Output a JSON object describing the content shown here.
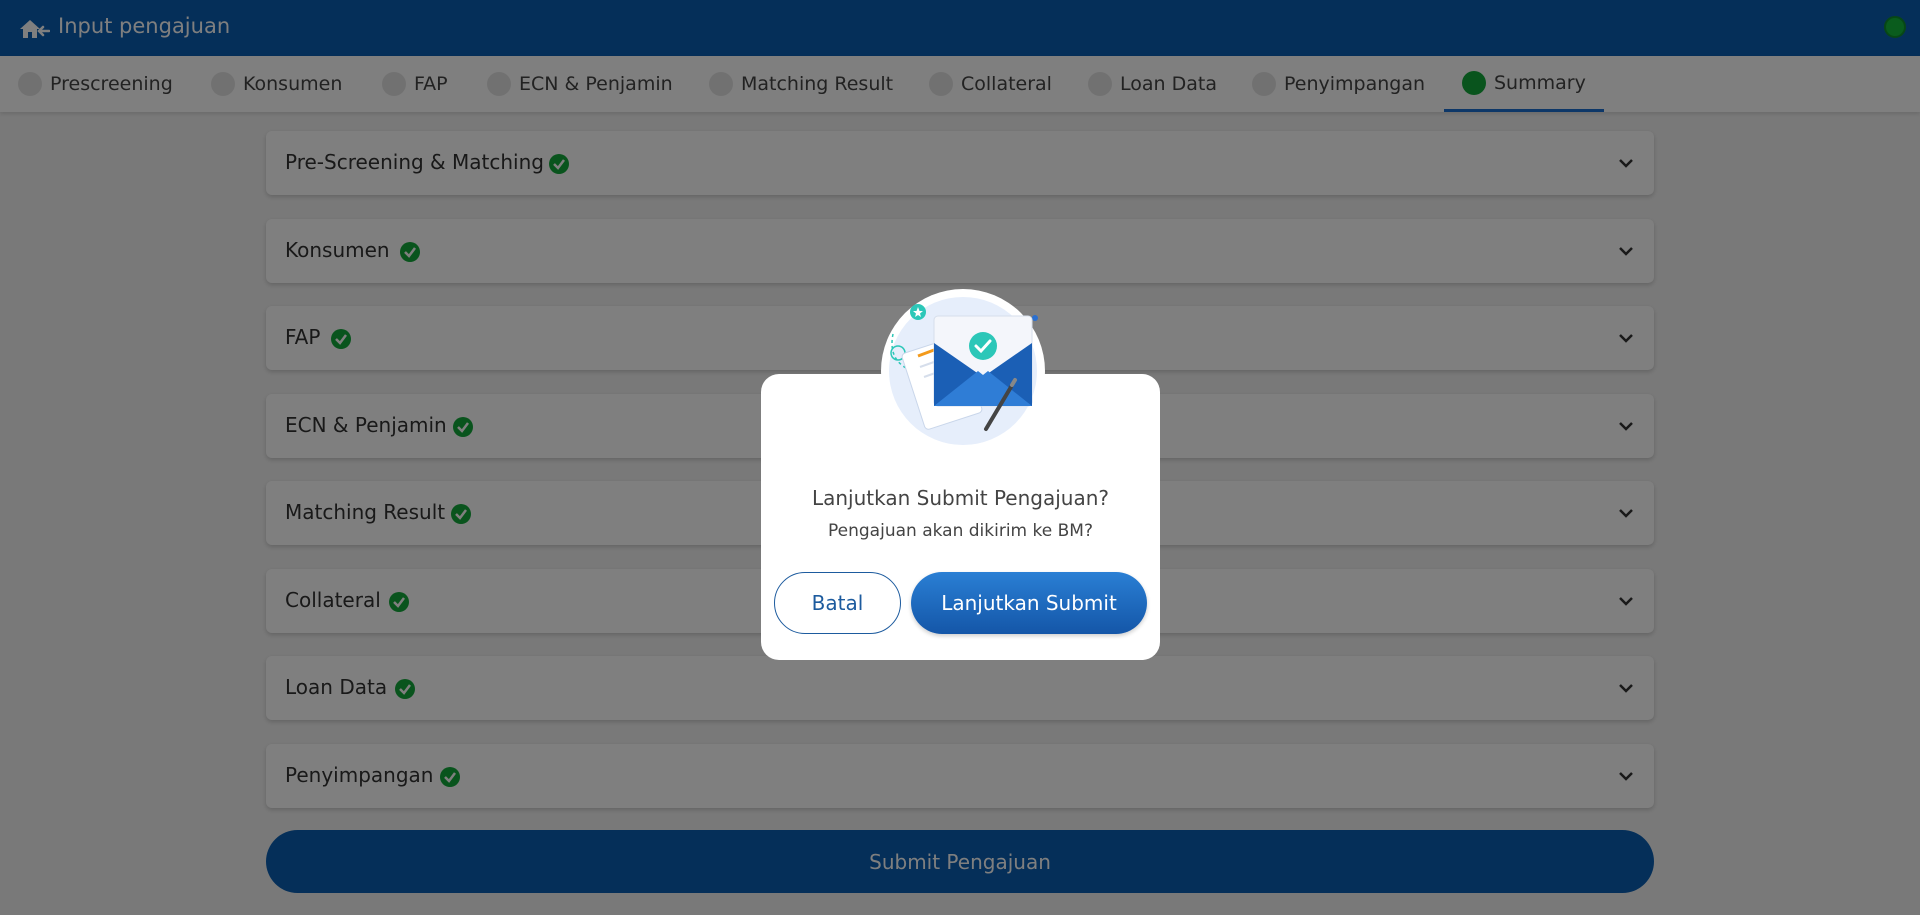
{
  "header": {
    "title": "Input pengajuan",
    "home_icon": "home-back-icon",
    "status_color": "#14b93a"
  },
  "tabs": [
    {
      "label": "Prescreening",
      "active": false
    },
    {
      "label": "Konsumen",
      "active": false
    },
    {
      "label": "FAP",
      "active": false
    },
    {
      "label": "ECN & Penjamin",
      "active": false
    },
    {
      "label": "Matching Result",
      "active": false
    },
    {
      "label": "Collateral",
      "active": false
    },
    {
      "label": "Loan Data",
      "active": false
    },
    {
      "label": "Penyimpangan",
      "active": false
    },
    {
      "label": "Summary",
      "active": true
    }
  ],
  "sections": [
    {
      "title": "Pre-Screening & Matching",
      "complete": true
    },
    {
      "title": "Konsumen",
      "complete": true
    },
    {
      "title": "FAP",
      "complete": true
    },
    {
      "title": "ECN & Penjamin",
      "complete": true
    },
    {
      "title": "Matching Result",
      "complete": true
    },
    {
      "title": "Collateral",
      "complete": true
    },
    {
      "title": "Loan Data",
      "complete": true
    },
    {
      "title": "Penyimpangan",
      "complete": true
    }
  ],
  "submit_label": "Submit Pengajuan",
  "modal": {
    "title": "Lanjutkan Submit Pengajuan?",
    "subtitle": "Pengajuan akan dikirim ke BM?",
    "cancel_label": "Batal",
    "confirm_label": "Lanjutkan Submit"
  },
  "colors": {
    "primary": "#0b5fb3",
    "success": "#13a83a",
    "active_tab_underline": "#1b6fd0"
  }
}
